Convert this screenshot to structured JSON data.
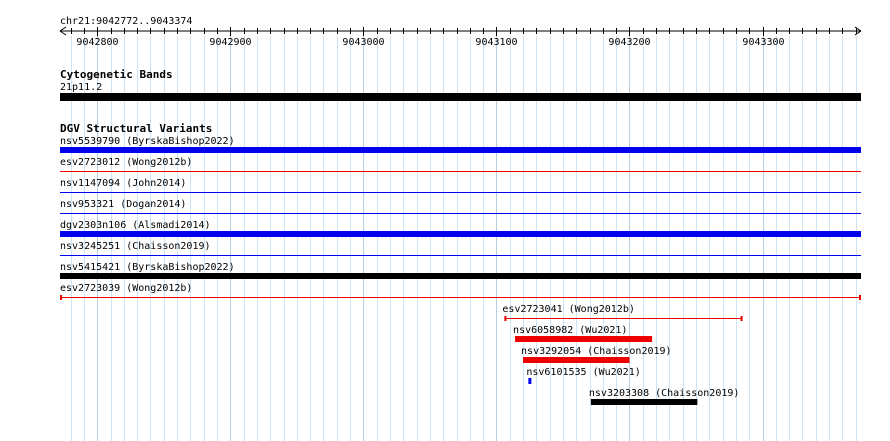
{
  "ruler": {
    "title": "chr21:9042772..9043374",
    "start": 9042772,
    "end": 9043374,
    "ticks": [
      {
        "pos": 9042800,
        "label": "9042800"
      },
      {
        "pos": 9042900,
        "label": "9042900"
      },
      {
        "pos": 9043000,
        "label": "9043000"
      },
      {
        "pos": 9043100,
        "label": "9043100"
      },
      {
        "pos": 9043200,
        "label": "9043200"
      },
      {
        "pos": 9043300,
        "label": "9043300"
      }
    ]
  },
  "cytoband": {
    "title": "Cytogenetic Bands",
    "band": {
      "label": "21p11.2",
      "start": 9042772,
      "end": 9043374,
      "color": "#000000"
    }
  },
  "dgv": {
    "title": "DGV Structural Variants",
    "features": [
      {
        "label": "nsv5539790 (ByrskaBishop2022)",
        "start": 9042772,
        "end": 9043374,
        "color": "#0000ee",
        "style": "thick"
      },
      {
        "label": "esv2723012 (Wong2012b)",
        "start": 9042772,
        "end": 9043374,
        "color": "#ee0000",
        "style": "thin"
      },
      {
        "label": "nsv1147094 (John2014)",
        "start": 9042772,
        "end": 9043374,
        "color": "#0000ee",
        "style": "thin"
      },
      {
        "label": "nsv953321 (Dogan2014)",
        "start": 9042772,
        "end": 9043374,
        "color": "#0000ee",
        "style": "thin"
      },
      {
        "label": "dgv2303n106 (Alsmadi2014)",
        "start": 9042772,
        "end": 9043374,
        "color": "#0000ee",
        "style": "thick"
      },
      {
        "label": "nsv3245251 (Chaisson2019)",
        "start": 9042772,
        "end": 9043374,
        "color": "#0000ee",
        "style": "thin"
      },
      {
        "label": "nsv5415421 (ByrskaBishop2022)",
        "start": 9042772,
        "end": 9043374,
        "color": "#000000",
        "style": "thick"
      },
      {
        "label": "esv2723039 (Wong2012b)",
        "start": 9042772,
        "end": 9043374,
        "color": "#ee0000",
        "style": "thin-capped"
      },
      {
        "label": "esv2723041 (Wong2012b)",
        "start": 9043106,
        "end": 9043285,
        "color": "#ee0000",
        "style": "thin-capped"
      },
      {
        "label": "nsv6058982 (Wu2021)",
        "start": 9043114,
        "end": 9043217,
        "color": "#ee0000",
        "style": "thick"
      },
      {
        "label": "nsv3292054 (Chaisson2019)",
        "start": 9043120,
        "end": 9043200,
        "color": "#ee0000",
        "style": "thick"
      },
      {
        "label": "nsv6101535 (Wu2021)",
        "start": 9043124,
        "end": 9043126,
        "color": "#0000ee",
        "style": "thick"
      },
      {
        "label": "nsv3203308 (Chaisson2019)",
        "start": 9043171,
        "end": 9043251,
        "color": "#000000",
        "style": "thick"
      }
    ]
  }
}
